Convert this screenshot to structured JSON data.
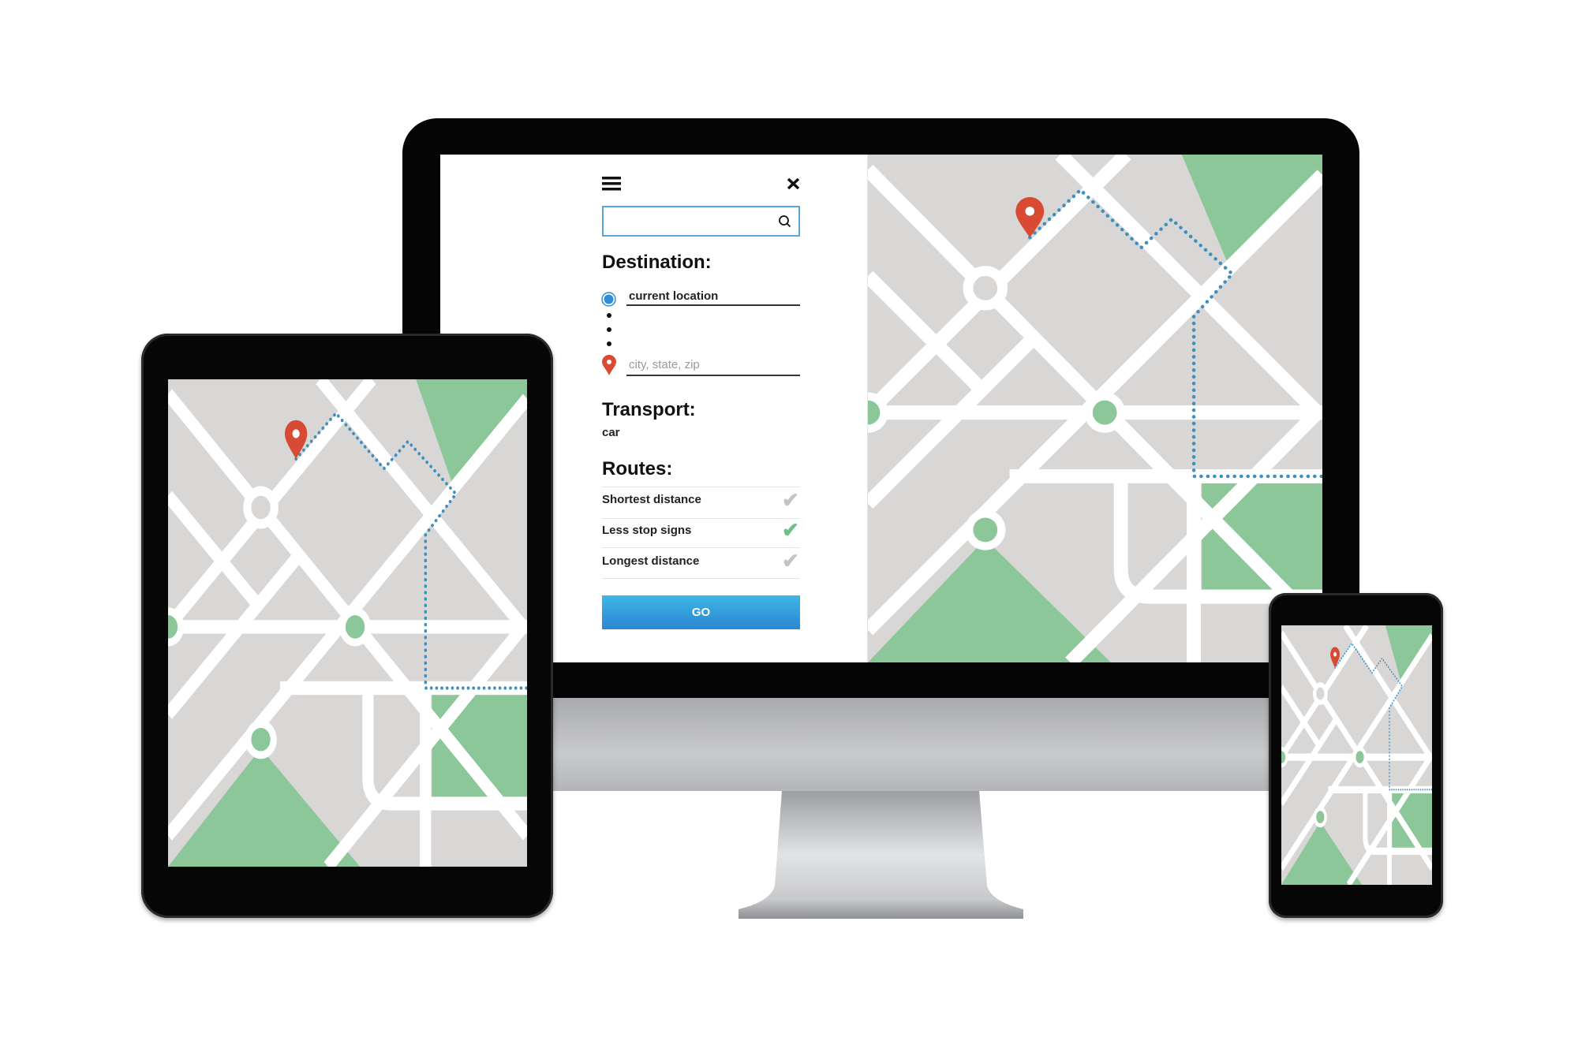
{
  "panel": {
    "search": {
      "value": "",
      "placeholder": ""
    },
    "destination_heading": "Destination:",
    "origin_value": "current location",
    "destination_placeholder": "city, state, zip",
    "transport_heading": "Transport:",
    "transport_value": "car",
    "routes_heading": "Routes:",
    "routes": [
      {
        "label": "Shortest distance",
        "selected": false
      },
      {
        "label": "Less stop signs",
        "selected": true
      },
      {
        "label": "Longest distance",
        "selected": false
      }
    ],
    "go_label": "GO",
    "icons": {
      "menu": "hamburger-icon",
      "close": "close-icon",
      "search": "search-icon",
      "origin": "radio-dot-icon",
      "destination": "map-pin-icon",
      "check": "checkmark-icon"
    }
  },
  "colors": {
    "accent_blue": "#2f8fd6",
    "route_blue": "#3d8fc0",
    "pin_red": "#d84a33",
    "park_green": "#8cc79a",
    "map_grey": "#d9d6d6",
    "check_selected": "#6fbf8a",
    "check_unselected": "#c4c4c4"
  }
}
